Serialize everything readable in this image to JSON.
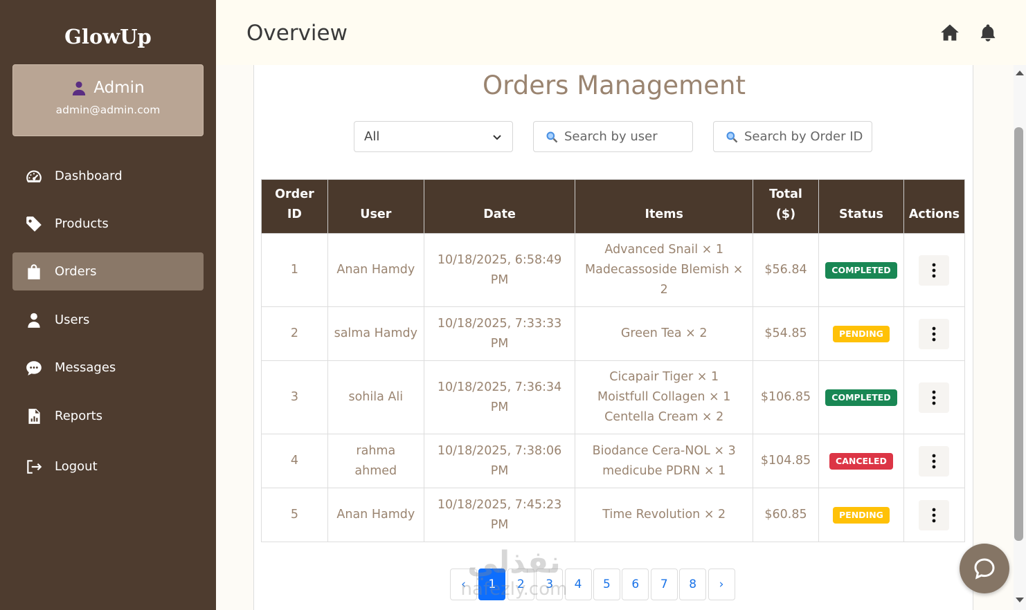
{
  "sidebar": {
    "brand": "GlowUp",
    "admin": {
      "name": "Admin",
      "email": "admin@admin.com"
    },
    "items": [
      {
        "label": "Dashboard",
        "icon": "gauge-icon",
        "active": false
      },
      {
        "label": "Products",
        "icon": "tag-icon",
        "active": false
      },
      {
        "label": "Orders",
        "icon": "shopping-bag-icon",
        "active": true
      },
      {
        "label": "Users",
        "icon": "user-icon",
        "active": false
      },
      {
        "label": "Messages",
        "icon": "chat-bubble-icon",
        "active": false
      },
      {
        "label": "Reports",
        "icon": "report-file-icon",
        "active": false
      },
      {
        "label": "Logout",
        "icon": "logout-icon",
        "active": false
      }
    ]
  },
  "header": {
    "title": "Overview",
    "icons": [
      "home-icon",
      "bell-icon"
    ]
  },
  "orders": {
    "title": "Orders Management",
    "filters": {
      "status_value": "All",
      "user_placeholder": "Search by user",
      "order_placeholder": "Search by Order ID"
    },
    "columns": [
      "Order ID",
      "User",
      "Date",
      "Items",
      "Total ($)",
      "Status",
      "Actions"
    ],
    "rows": [
      {
        "id": "1",
        "user": "Anan Hamdy",
        "date": "10/18/2025, 6:58:49 PM",
        "items": [
          "Advanced Snail × 1",
          "Madecassoside Blemish × 2"
        ],
        "total": "$56.84",
        "status": "COMPLETED"
      },
      {
        "id": "2",
        "user": "salma Hamdy",
        "date": "10/18/2025, 7:33:33 PM",
        "items": [
          "Green Tea × 2"
        ],
        "total": "$54.85",
        "status": "PENDING"
      },
      {
        "id": "3",
        "user": "sohila Ali",
        "date": "10/18/2025, 7:36:34 PM",
        "items": [
          "Cicapair Tiger × 1",
          "Moistfull Collagen × 1",
          "Centella Cream × 2"
        ],
        "total": "$106.85",
        "status": "COMPLETED"
      },
      {
        "id": "4",
        "user": "rahma ahmed",
        "date": "10/18/2025, 7:38:06 PM",
        "items": [
          "Biodance Cera-NOL × 3",
          "medicube PDRN × 1"
        ],
        "total": "$104.85",
        "status": "CANCELED"
      },
      {
        "id": "5",
        "user": "Anan Hamdy",
        "date": "10/18/2025, 7:45:23 PM",
        "items": [
          "Time Revolution × 2"
        ],
        "total": "$60.85",
        "status": "PENDING"
      }
    ],
    "status_colors": {
      "COMPLETED": "#198754",
      "PENDING": "#ffc107",
      "CANCELED": "#dc3545"
    },
    "pagination": {
      "prev": "‹",
      "next": "›",
      "pages": [
        "1",
        "2",
        "3",
        "4",
        "5",
        "6",
        "7",
        "8"
      ],
      "current": "1"
    }
  },
  "watermark": {
    "arabic": "نفذلي",
    "latin": "nafezly.com"
  },
  "colors": {
    "sidebar": "#4e3c2f",
    "table_header": "#4a392c",
    "accent_text": "#9a8470",
    "active_nav": "#8a7868"
  }
}
